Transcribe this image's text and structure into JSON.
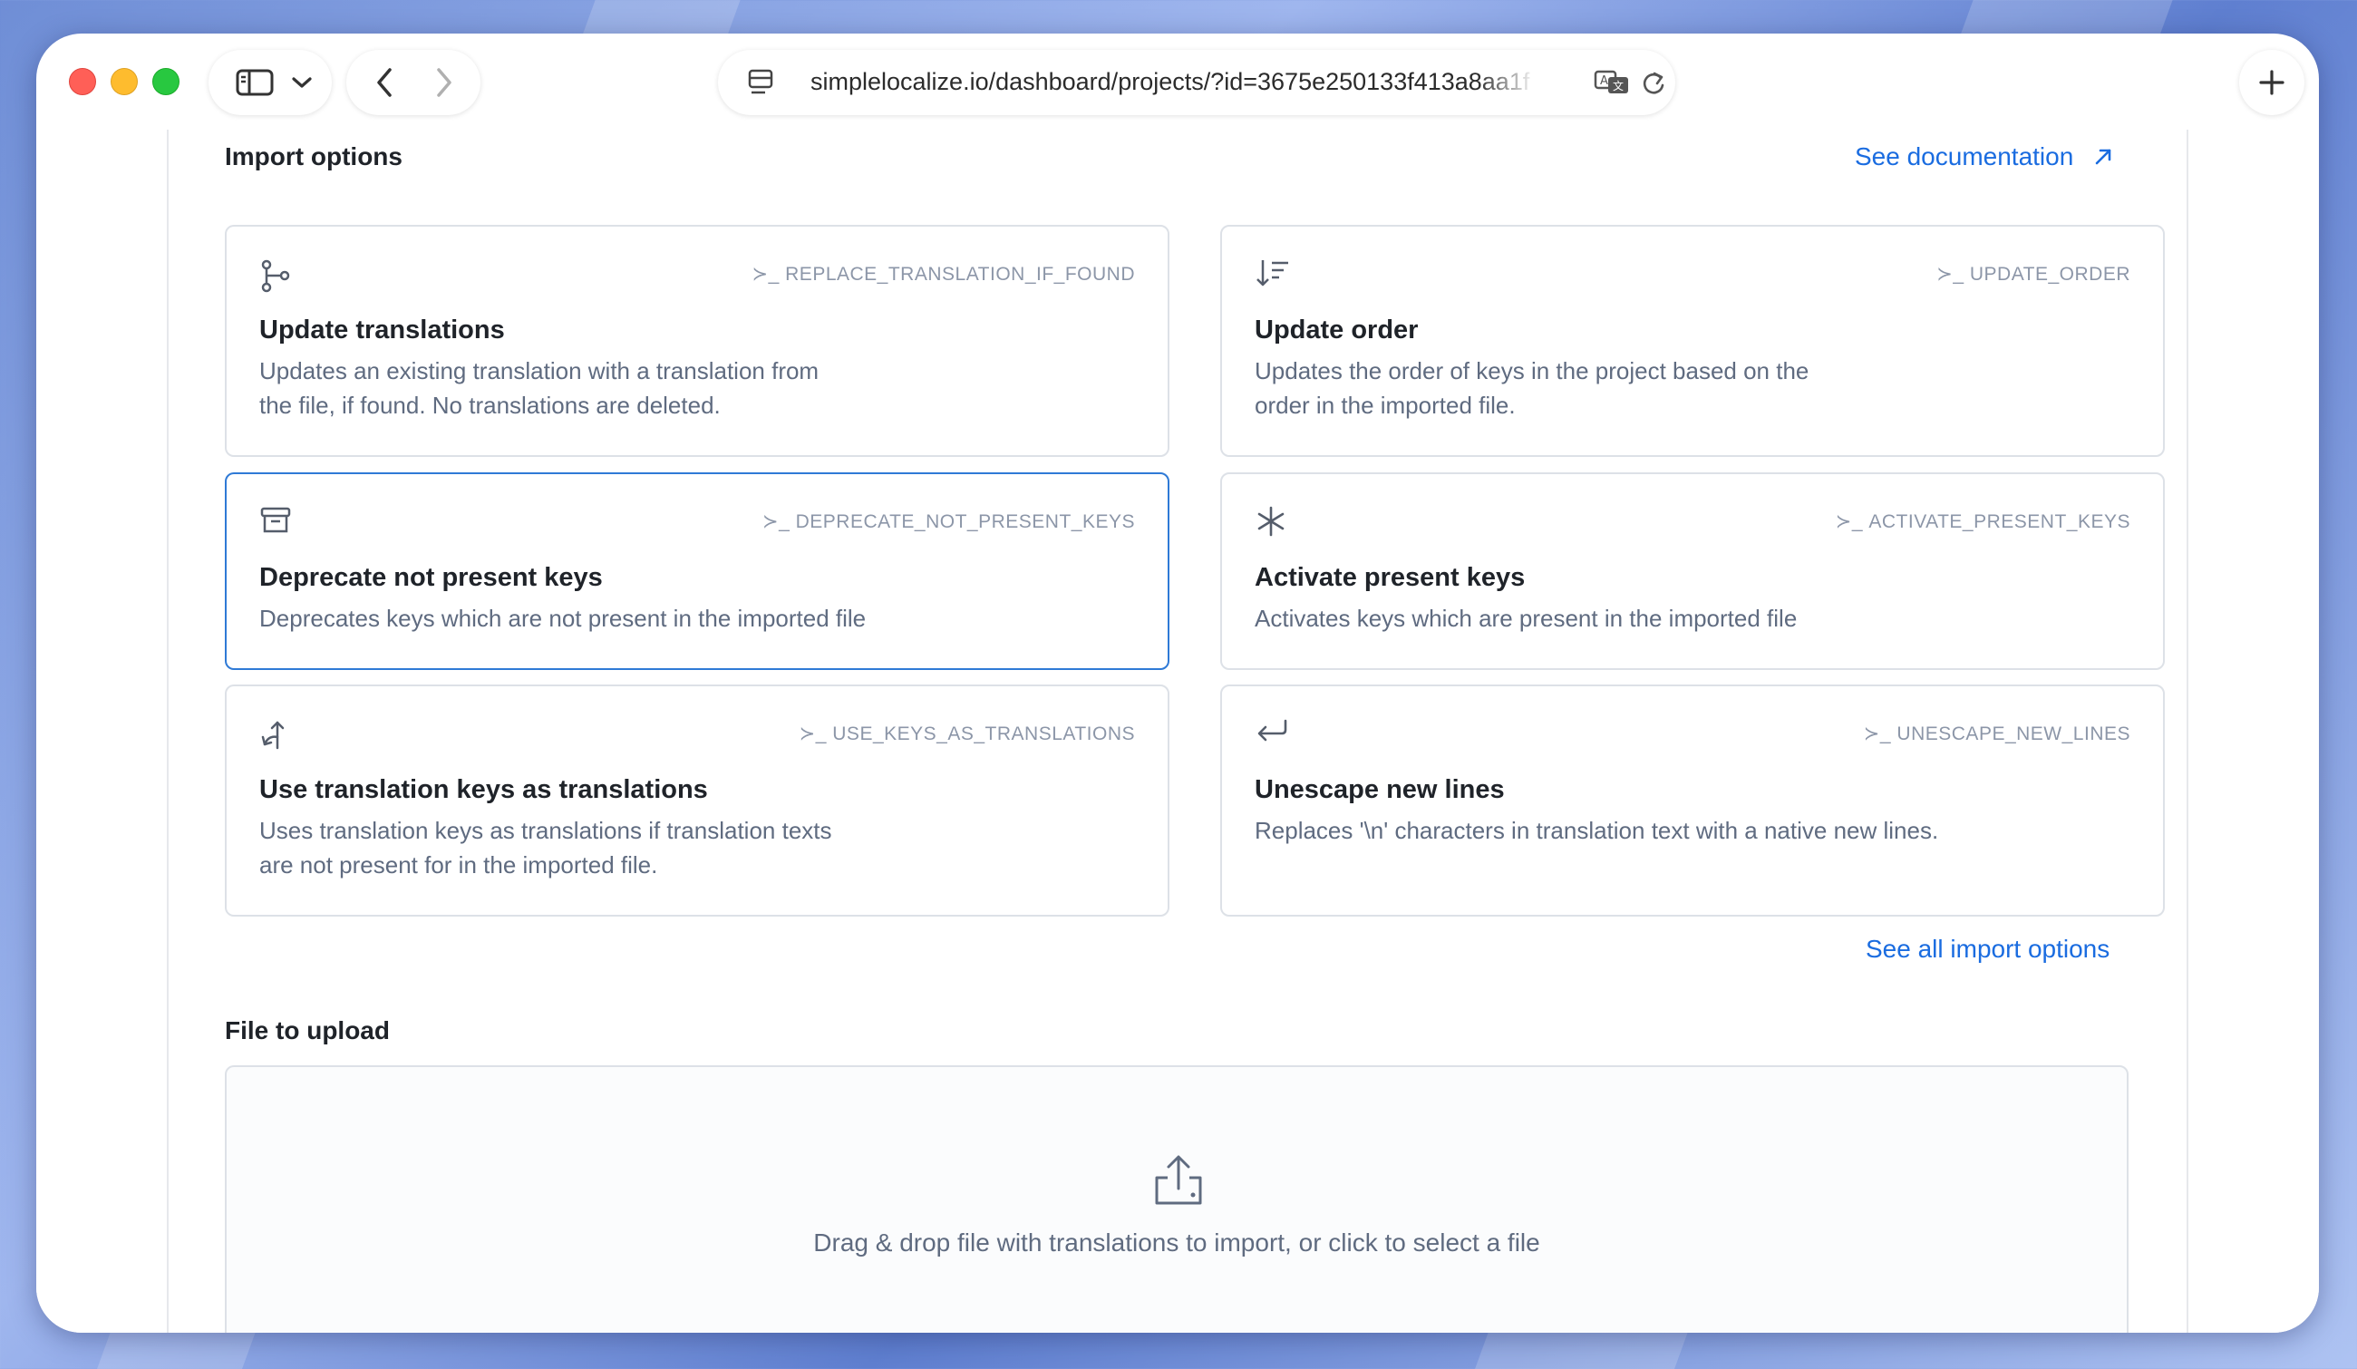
{
  "browser": {
    "url": "simplelocalize.io/dashboard/projects/?id=3675e250133f413a8aa1f"
  },
  "import_options": {
    "title": "Import options",
    "doc_link": "See documentation",
    "see_all_link": "See all import options",
    "cards": [
      {
        "icon": "git-branch-icon",
        "command": "REPLACE_TRANSLATION_IF_FOUND",
        "title": "Update translations",
        "description": "Updates an existing translation with a translation from the file, if found. No translations are deleted."
      },
      {
        "icon": "sort-descending-icon",
        "command": "UPDATE_ORDER",
        "title": "Update order",
        "description": "Updates the order of keys in the project based on the order in the imported file."
      },
      {
        "icon": "archive-icon",
        "command": "DEPRECATE_NOT_PRESENT_KEYS",
        "title": "Deprecate not present keys",
        "description": "Deprecates keys which are not present in the imported file",
        "selected": true
      },
      {
        "icon": "asterisk-icon",
        "command": "ACTIVATE_PRESENT_KEYS",
        "title": "Activate present keys",
        "description": "Activates keys which are present in the imported file"
      },
      {
        "icon": "split-arrow-icon",
        "command": "USE_KEYS_AS_TRANSLATIONS",
        "title": "Use translation keys as translations",
        "description": "Uses translation keys as translations if translation texts are not present for in the imported file."
      },
      {
        "icon": "return-arrow-icon",
        "command": "UNESCAPE_NEW_LINES",
        "title": "Unescape new lines",
        "description": "Replaces '\\n' characters in translation text with a native new lines."
      }
    ]
  },
  "upload": {
    "title": "File to upload",
    "icon": "upload-tray-icon",
    "text": "Drag & drop file with translations to import, or click to select a file"
  },
  "cmd_prefix": "≻_"
}
